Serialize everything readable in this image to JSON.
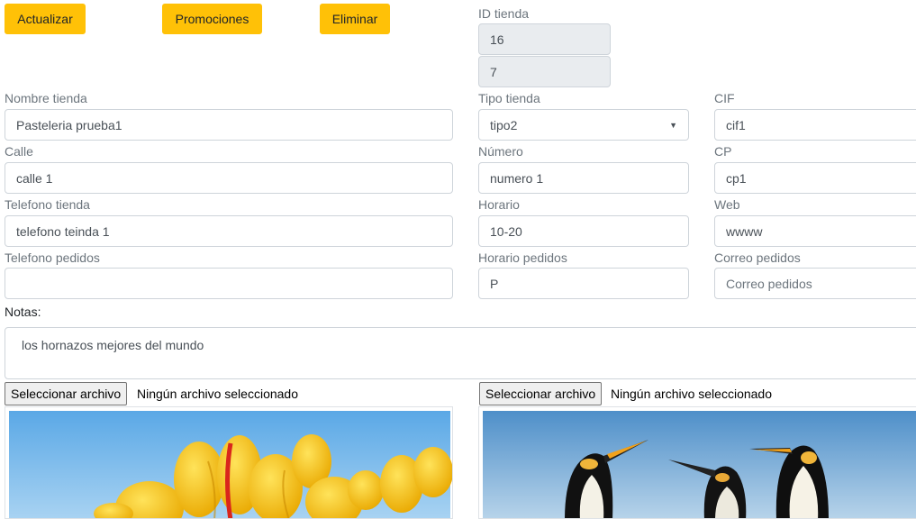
{
  "toolbar": {
    "update_label": "Actualizar",
    "promotions_label": "Promociones",
    "delete_label": "Eliminar"
  },
  "store_id": {
    "label": "ID tienda",
    "value1": "16",
    "value2": "7"
  },
  "form": {
    "name": {
      "label": "Nombre tienda",
      "value": "Pasteleria prueba1"
    },
    "type": {
      "label": "Tipo tienda",
      "value": "tipo2"
    },
    "cif": {
      "label": "CIF",
      "value": "cif1"
    },
    "street": {
      "label": "Calle",
      "value": "calle 1"
    },
    "number": {
      "label": "Número",
      "value": "numero 1"
    },
    "cp": {
      "label": "CP",
      "value": "cp1"
    },
    "phone": {
      "label": "Telefono tienda",
      "value": "telefono teinda 1"
    },
    "schedule": {
      "label": "Horario",
      "value": "10-20"
    },
    "web": {
      "label": "Web",
      "value": "wwww"
    },
    "orders_phone": {
      "label": "Telefono pedidos",
      "value": ""
    },
    "orders_schedule": {
      "label": "Horario pedidos",
      "value": "P"
    },
    "orders_email": {
      "label": "Correo pedidos",
      "value": "",
      "placeholder": "Correo pedidos"
    },
    "notes": {
      "label": "Notas:",
      "value": "los hornazos mejores del mundo"
    }
  },
  "files": {
    "left": {
      "button": "Seleccionar archivo",
      "status": "Ningún archivo seleccionado",
      "image": "tulips-photo"
    },
    "right": {
      "button": "Seleccionar archivo",
      "status": "Ningún archivo seleccionado",
      "image": "penguins-photo"
    }
  },
  "colors": {
    "accent": "#ffc107",
    "readonly_bg": "#e9ecef",
    "border": "#ced4da"
  }
}
